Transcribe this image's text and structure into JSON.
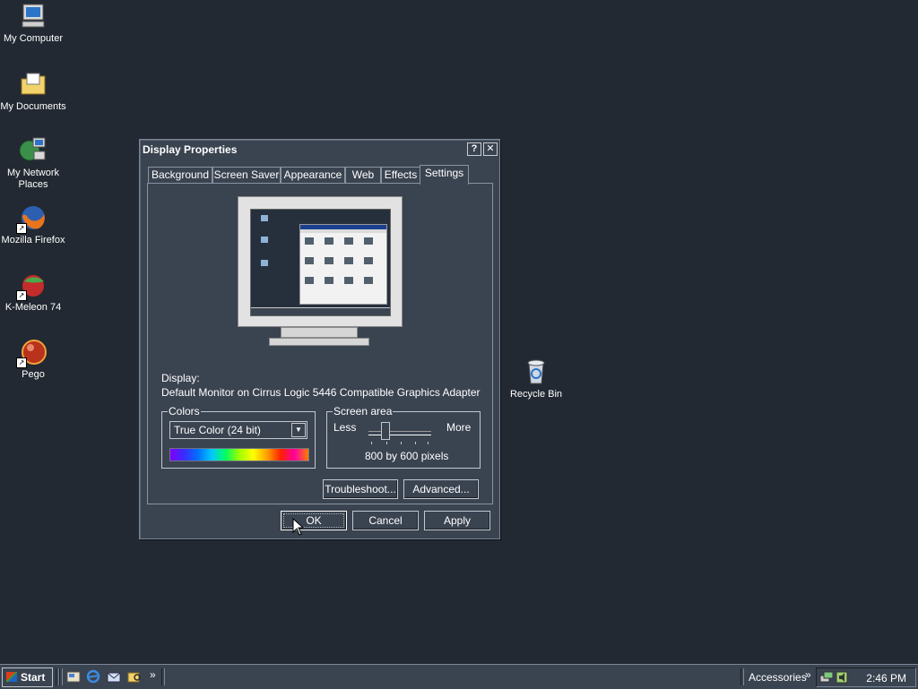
{
  "desktop": {
    "icons": [
      {
        "label": "My Computer",
        "icon": "my-computer-icon"
      },
      {
        "label": "My Documents",
        "icon": "my-documents-icon"
      },
      {
        "label": "My Network Places",
        "icon": "network-places-icon"
      },
      {
        "label": "Mozilla Firefox",
        "icon": "firefox-icon"
      },
      {
        "label": "K-Meleon 74",
        "icon": "k-meleon-icon"
      },
      {
        "label": "Pego",
        "icon": "pego-icon"
      },
      {
        "label": "Recycle Bin",
        "icon": "recycle-bin-icon"
      }
    ]
  },
  "dialog": {
    "title": "Display Properties",
    "help_btn": "?",
    "close_btn": "✕",
    "tabs": [
      "Background",
      "Screen Saver",
      "Appearance",
      "Web",
      "Effects",
      "Settings"
    ],
    "active_tab": "Settings",
    "display_label": "Display:",
    "display_value": "Default Monitor on Cirrus Logic 5446 Compatible Graphics Adapter",
    "colors": {
      "title": "Colors",
      "selected": "True Color (24 bit)"
    },
    "screen_area": {
      "title": "Screen area",
      "less": "Less",
      "more": "More",
      "value": "800 by 600 pixels",
      "slider_position": 0.25
    },
    "buttons": {
      "troubleshoot": "Troubleshoot...",
      "advanced": "Advanced...",
      "ok": "OK",
      "cancel": "Cancel",
      "apply": "Apply"
    }
  },
  "taskbar": {
    "start": "Start",
    "quick_launch_more": "»",
    "accessories": "Accessories",
    "accessories_more": "»",
    "clock": "2:46 PM"
  }
}
